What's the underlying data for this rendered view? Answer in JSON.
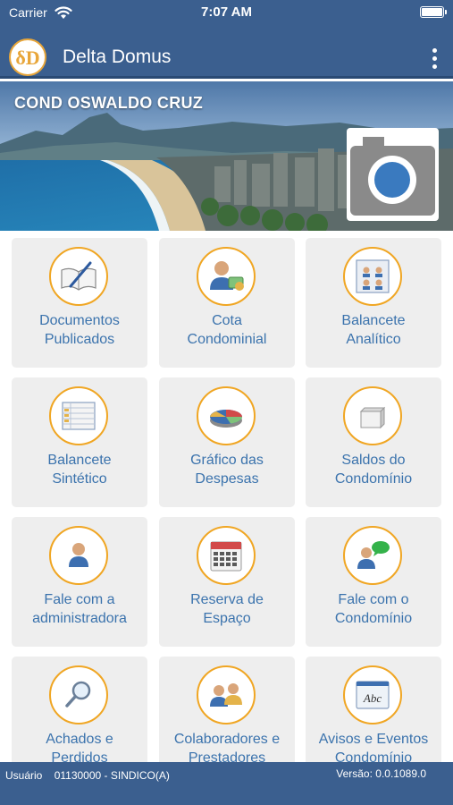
{
  "status_bar": {
    "carrier": "Carrier",
    "time": "7:07 AM",
    "icons": [
      "wifi-icon",
      "battery-icon"
    ]
  },
  "app_bar": {
    "logo_text": "δD",
    "title": "Delta Domus",
    "menu_icon": "more-vertical-icon"
  },
  "banner": {
    "title": "COND OSWALDO CRUZ",
    "camera_icon": "camera-icon"
  },
  "tiles": [
    {
      "line1": "Documentos",
      "line2": "Publicados",
      "icon": "document-pen-icon"
    },
    {
      "line1": "Cota",
      "line2": "Condominial",
      "icon": "person-money-icon"
    },
    {
      "line1": "Balancete",
      "line2": "Analítico",
      "icon": "org-sheet-icon"
    },
    {
      "line1": "Balancete",
      "line2": "Sintético",
      "icon": "spreadsheet-icon"
    },
    {
      "line1": "Gráfico das",
      "line2": "Despesas",
      "icon": "pie-chart-icon"
    },
    {
      "line1": "Saldos do",
      "line2": "Condomínio",
      "icon": "open-box-icon"
    },
    {
      "line1": "Fale com a",
      "line2": "administradora",
      "icon": "person-icon"
    },
    {
      "line1": "Reserva de",
      "line2": "Espaço",
      "icon": "calendar-icon"
    },
    {
      "line1": "Fale com o",
      "line2": "Condomínio",
      "icon": "person-chat-icon"
    },
    {
      "line1": "Achados e",
      "line2": "Perdidos",
      "icon": "magnifier-icon"
    },
    {
      "line1": "Colaboradores e",
      "line2": "Prestadores",
      "icon": "people-icon"
    },
    {
      "line1": "Avisos e Eventos",
      "line2": "Condomínio",
      "icon": "abc-window-icon"
    }
  ],
  "footer": {
    "user_label": "Usuário",
    "user_value": "01130000 - SINDICO(A)",
    "version_label": "Versão:",
    "version_value": "0.0.1089.0"
  },
  "colors": {
    "brand": "#3b5f8f",
    "tile_bg": "#eeeeee",
    "tile_text": "#3b73ad",
    "icon_ring": "#f0a623"
  }
}
